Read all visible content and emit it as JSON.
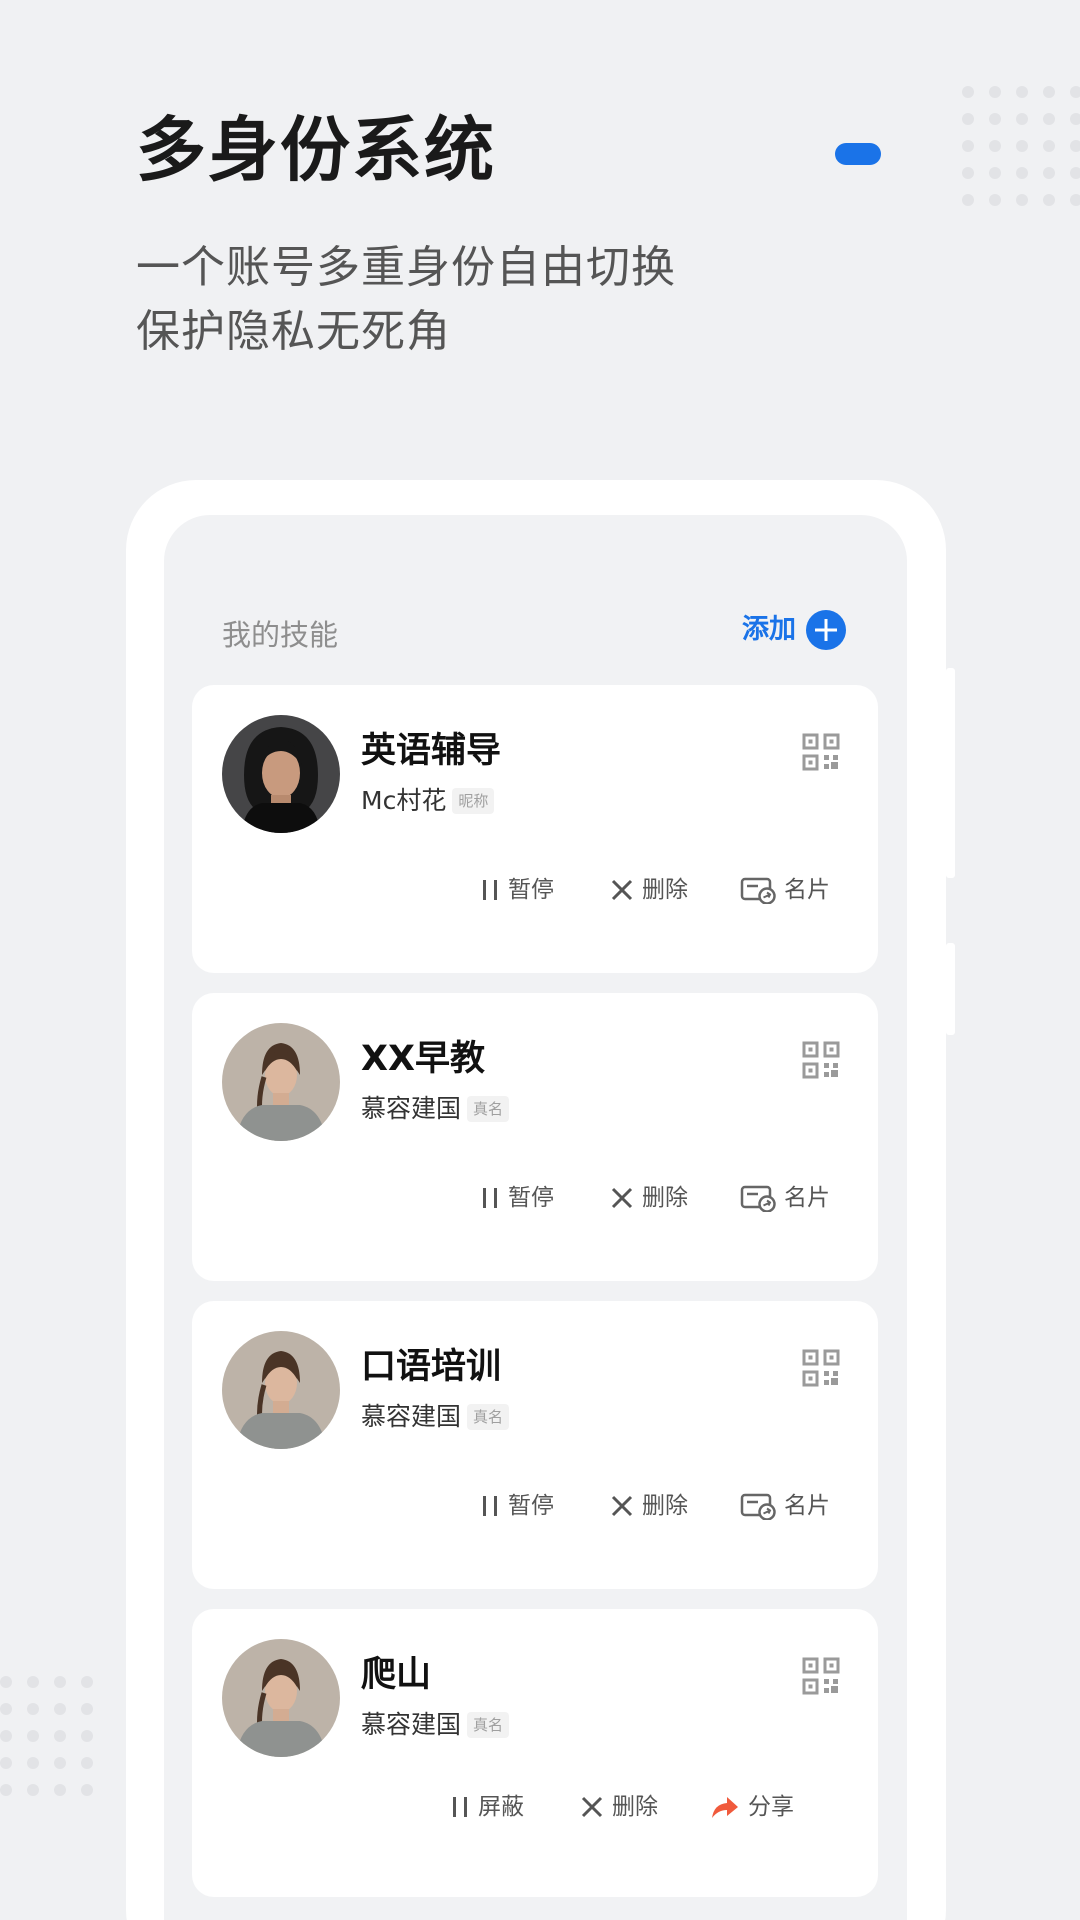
{
  "hero": {
    "title": "多身份系统",
    "subtitle_line1": "一个账号多重身份自由切换",
    "subtitle_line2": "保护隐私无死角",
    "accent_color": "#1a73e8"
  },
  "section": {
    "title": "我的技能",
    "add_label": "添加",
    "add_icon": "plus-circle-icon"
  },
  "cards": [
    {
      "title": "英语辅导",
      "name": "Mc村花",
      "tag": "昵称",
      "avatar": "avatar-dark-hair-woman",
      "qr_icon": "qr-code-icon",
      "actions": [
        {
          "label": "暂停",
          "icon": "pause-icon"
        },
        {
          "label": "删除",
          "icon": "close-icon"
        },
        {
          "label": "名片",
          "icon": "card-share-icon"
        }
      ]
    },
    {
      "title": "XX早教",
      "name": "慕容建国",
      "tag": "真名",
      "avatar": "avatar-light-woman",
      "qr_icon": "qr-code-icon",
      "actions": [
        {
          "label": "暂停",
          "icon": "pause-icon"
        },
        {
          "label": "删除",
          "icon": "close-icon"
        },
        {
          "label": "名片",
          "icon": "card-share-icon"
        }
      ]
    },
    {
      "title": "口语培训",
      "name": "慕容建国",
      "tag": "真名",
      "avatar": "avatar-light-woman",
      "qr_icon": "qr-code-icon",
      "actions": [
        {
          "label": "暂停",
          "icon": "pause-icon"
        },
        {
          "label": "删除",
          "icon": "close-icon"
        },
        {
          "label": "名片",
          "icon": "card-share-icon"
        }
      ]
    },
    {
      "title": "爬山",
      "name": "慕容建国",
      "tag": "真名",
      "avatar": "avatar-light-woman",
      "qr_icon": "qr-code-icon",
      "actions": [
        {
          "label": "屏蔽",
          "icon": "pause-icon"
        },
        {
          "label": "删除",
          "icon": "close-icon"
        },
        {
          "label": "分享",
          "icon": "share-arrow-icon",
          "color": "#f05a3c"
        }
      ]
    }
  ]
}
